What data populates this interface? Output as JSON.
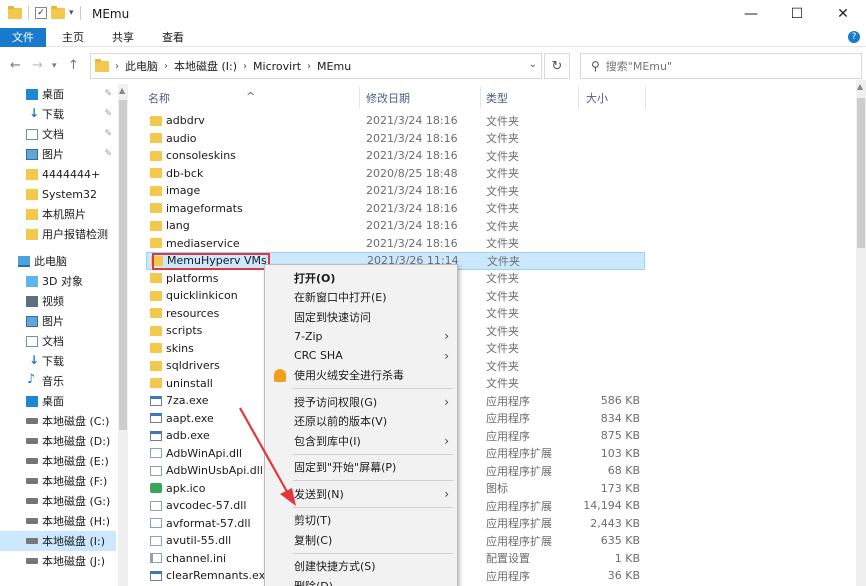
{
  "window": {
    "title": "MEmu",
    "controls": {
      "minimize": "—",
      "maximize": "☐",
      "close": "✕"
    }
  },
  "ribbon": {
    "tabs": [
      "文件",
      "主页",
      "共享",
      "查看"
    ],
    "help": "?"
  },
  "address": {
    "crumbs": [
      "此电脑",
      "本地磁盘 (I:)",
      "Microvirt",
      "MEmu"
    ],
    "search_placeholder": "搜索\"MEmu\""
  },
  "sidebar": {
    "items": [
      {
        "label": "桌面",
        "icon": "desktop-icon",
        "pinned": true
      },
      {
        "label": "下载",
        "icon": "download-icon",
        "pinned": true
      },
      {
        "label": "文档",
        "icon": "document-icon",
        "pinned": true
      },
      {
        "label": "图片",
        "icon": "pictures-icon",
        "pinned": true
      },
      {
        "label": "4444444+",
        "icon": "folder-icon"
      },
      {
        "label": "System32",
        "icon": "folder-icon"
      },
      {
        "label": "本机照片",
        "icon": "folder-icon"
      },
      {
        "label": "用户报错检测",
        "icon": "folder-icon"
      },
      {
        "label": "此电脑",
        "icon": "pc-icon"
      },
      {
        "label": "3D 对象",
        "icon": "cube-icon"
      },
      {
        "label": "视频",
        "icon": "video-icon"
      },
      {
        "label": "图片",
        "icon": "pictures-icon"
      },
      {
        "label": "文档",
        "icon": "document-icon"
      },
      {
        "label": "下载",
        "icon": "download-icon"
      },
      {
        "label": "音乐",
        "icon": "music-icon"
      },
      {
        "label": "桌面",
        "icon": "desktop-icon"
      },
      {
        "label": "本地磁盘 (C:)",
        "icon": "drive-icon"
      },
      {
        "label": "本地磁盘 (D:)",
        "icon": "drive-icon"
      },
      {
        "label": "本地磁盘 (E:)",
        "icon": "drive-icon"
      },
      {
        "label": "本地磁盘 (F:)",
        "icon": "drive-icon"
      },
      {
        "label": "本地磁盘 (G:)",
        "icon": "drive-icon"
      },
      {
        "label": "本地磁盘 (H:)",
        "icon": "drive-icon"
      },
      {
        "label": "本地磁盘 (I:)",
        "icon": "drive-icon",
        "selected": true
      },
      {
        "label": "本地磁盘 (J:)",
        "icon": "drive-icon"
      }
    ]
  },
  "columns": {
    "name": "名称",
    "date": "修改日期",
    "type": "类型",
    "size": "大小"
  },
  "files": [
    {
      "name": "adbdrv",
      "date": "2021/3/24 18:16",
      "type": "文件夹",
      "size": "",
      "kind": "folder"
    },
    {
      "name": "audio",
      "date": "2021/3/24 18:16",
      "type": "文件夹",
      "size": "",
      "kind": "folder"
    },
    {
      "name": "consoleskins",
      "date": "2021/3/24 18:16",
      "type": "文件夹",
      "size": "",
      "kind": "folder"
    },
    {
      "name": "db-bck",
      "date": "2020/8/25 18:48",
      "type": "文件夹",
      "size": "",
      "kind": "folder"
    },
    {
      "name": "image",
      "date": "2021/3/24 18:16",
      "type": "文件夹",
      "size": "",
      "kind": "folder"
    },
    {
      "name": "imageformats",
      "date": "2021/3/24 18:16",
      "type": "文件夹",
      "size": "",
      "kind": "folder"
    },
    {
      "name": "lang",
      "date": "2021/3/24 18:16",
      "type": "文件夹",
      "size": "",
      "kind": "folder"
    },
    {
      "name": "mediaservice",
      "date": "2021/3/24 18:16",
      "type": "文件夹",
      "size": "",
      "kind": "folder"
    },
    {
      "name": "MemuHyperv VMs",
      "date": "2021/3/26 11:14",
      "type": "文件夹",
      "size": "",
      "kind": "folder",
      "selected": true
    },
    {
      "name": "platforms",
      "date": "",
      "type": "文件夹",
      "size": "",
      "kind": "folder"
    },
    {
      "name": "quicklinkicon",
      "date": "",
      "type": "文件夹",
      "size": "",
      "kind": "folder"
    },
    {
      "name": "resources",
      "date": "",
      "type": "文件夹",
      "size": "",
      "kind": "folder"
    },
    {
      "name": "scripts",
      "date": "",
      "type": "文件夹",
      "size": "",
      "kind": "folder"
    },
    {
      "name": "skins",
      "date": "",
      "type": "文件夹",
      "size": "",
      "kind": "folder"
    },
    {
      "name": "sqldrivers",
      "date": "",
      "type": "文件夹",
      "size": "",
      "kind": "folder"
    },
    {
      "name": "uninstall",
      "date": "",
      "type": "文件夹",
      "size": "",
      "kind": "folder"
    },
    {
      "name": "7za.exe",
      "date": "",
      "type": "应用程序",
      "size": "586 KB",
      "kind": "exe"
    },
    {
      "name": "aapt.exe",
      "date": "",
      "type": "应用程序",
      "size": "834 KB",
      "kind": "exe"
    },
    {
      "name": "adb.exe",
      "date": "",
      "type": "应用程序",
      "size": "875 KB",
      "kind": "exe"
    },
    {
      "name": "AdbWinApi.dll",
      "date": "",
      "type": "应用程序扩展",
      "size": "103 KB",
      "kind": "dll"
    },
    {
      "name": "AdbWinUsbApi.dll",
      "date": "",
      "type": "应用程序扩展",
      "size": "68 KB",
      "kind": "dll"
    },
    {
      "name": "apk.ico",
      "date": "",
      "type": "图标",
      "size": "173 KB",
      "kind": "ico"
    },
    {
      "name": "avcodec-57.dll",
      "date": "",
      "type": "应用程序扩展",
      "size": "14,194 KB",
      "kind": "dll"
    },
    {
      "name": "avformat-57.dll",
      "date": "",
      "type": "应用程序扩展",
      "size": "2,443 KB",
      "kind": "dll"
    },
    {
      "name": "avutil-55.dll",
      "date": "",
      "type": "应用程序扩展",
      "size": "635 KB",
      "kind": "dll"
    },
    {
      "name": "channel.ini",
      "date": "",
      "type": "配置设置",
      "size": "1 KB",
      "kind": "ini"
    },
    {
      "name": "clearRemnants.exe",
      "date": "",
      "type": "应用程序",
      "size": "36 KB",
      "kind": "exe"
    }
  ],
  "context_menu": {
    "items": [
      {
        "label": "打开(O)",
        "bold": true
      },
      {
        "label": "在新窗口中打开(E)"
      },
      {
        "label": "固定到快速访问"
      },
      {
        "label": "7-Zip",
        "submenu": true
      },
      {
        "label": "CRC SHA",
        "submenu": true
      },
      {
        "label": "使用火绒安全进行杀毒",
        "icon": "huorong-icon"
      },
      {
        "sep": true
      },
      {
        "label": "授予访问权限(G)",
        "submenu": true
      },
      {
        "label": "还原以前的版本(V)"
      },
      {
        "label": "包含到库中(I)",
        "submenu": true
      },
      {
        "sep": true
      },
      {
        "label": "固定到\"开始\"屏幕(P)"
      },
      {
        "sep": true
      },
      {
        "label": "发送到(N)",
        "submenu": true
      },
      {
        "sep": true
      },
      {
        "label": "剪切(T)"
      },
      {
        "label": "复制(C)"
      },
      {
        "sep": true
      },
      {
        "label": "创建快捷方式(S)"
      },
      {
        "label": "删除(D)"
      }
    ]
  },
  "colors": {
    "accent": "#1979ca",
    "selection": "#cce8ff",
    "annotation": "#e0393d"
  }
}
